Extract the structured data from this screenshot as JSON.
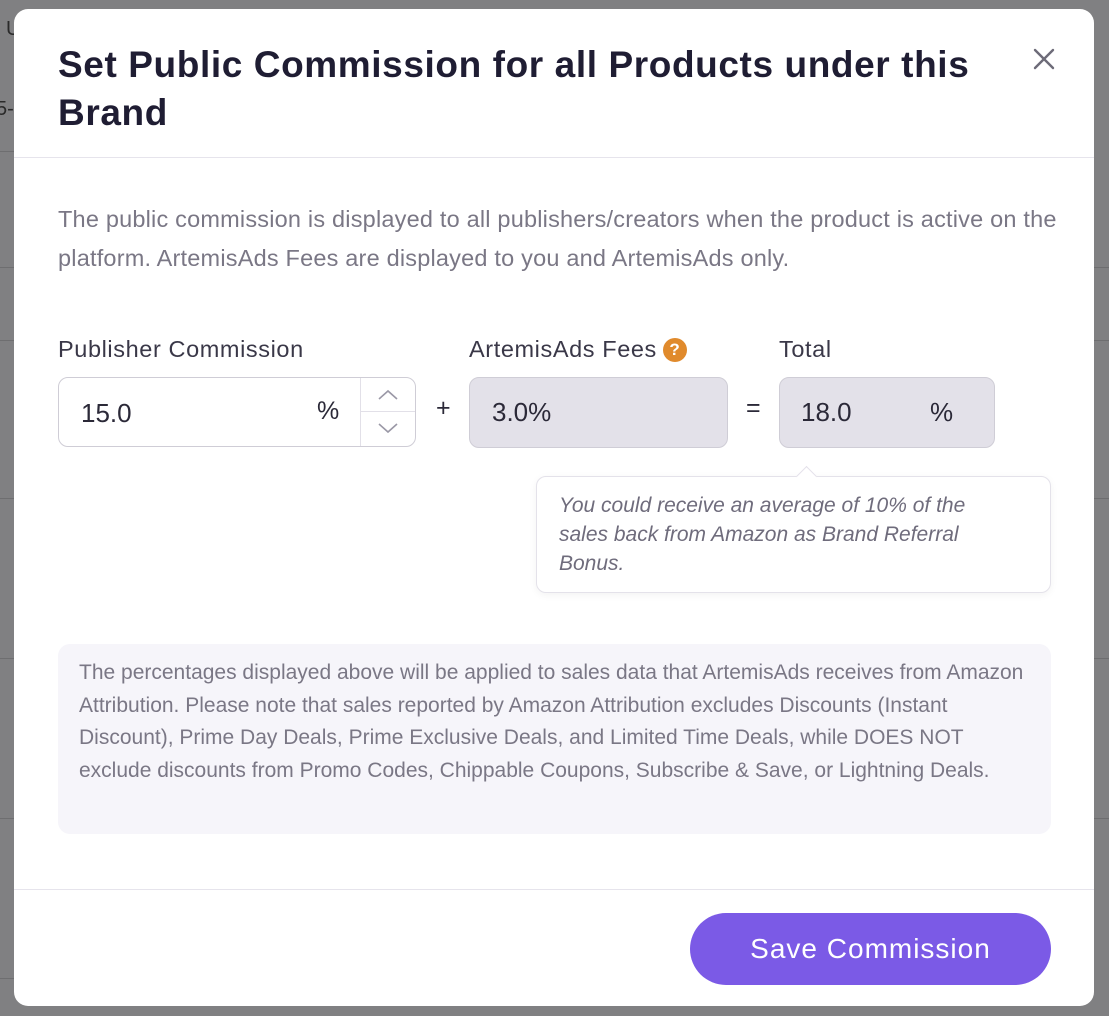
{
  "background": {
    "fragment_1": "U",
    "fragment_2": "5-"
  },
  "modal": {
    "title": "Set Public Commission for all Products under this Brand",
    "close_icon": "close-icon",
    "description": "The public commission is displayed to all publishers/creators when the product is active on the platform. ArtemisAds Fees are displayed to you and ArtemisAds only.",
    "publisher_commission": {
      "label": "Publisher Commission",
      "value": "15.0",
      "suffix": "%"
    },
    "plus_operator": "+",
    "artemis_fees": {
      "label": "ArtemisAds Fees",
      "help_icon": "question-circle-icon",
      "help_glyph": "?",
      "value": "3.0%"
    },
    "equals_operator": "=",
    "total": {
      "label": "Total",
      "value": "18.0",
      "suffix": "%"
    },
    "tooltip": "You could receive an average of 10% of the sales back from Amazon as Brand Referral Bonus.",
    "info_note": "The percentages displayed above will be applied to sales data that ArtemisAds receives from Amazon Attribution. Please note that sales reported by Amazon Attribution excludes Discounts (Instant Discount), Prime Day Deals, Prime Exclusive Deals, and Limited Time Deals, while DOES NOT exclude discounts from Promo Codes, Chippable Coupons, Subscribe & Save, or Lightning Deals.",
    "save_button": "Save Commission"
  },
  "colors": {
    "primary": "#7b5ae6",
    "help_icon": "#e08a2c",
    "title": "#1f1d33",
    "muted_text": "#7a7785",
    "readonly_field": "#e3e1e9",
    "note_background": "#f6f5fa",
    "overlay": "#808082"
  }
}
